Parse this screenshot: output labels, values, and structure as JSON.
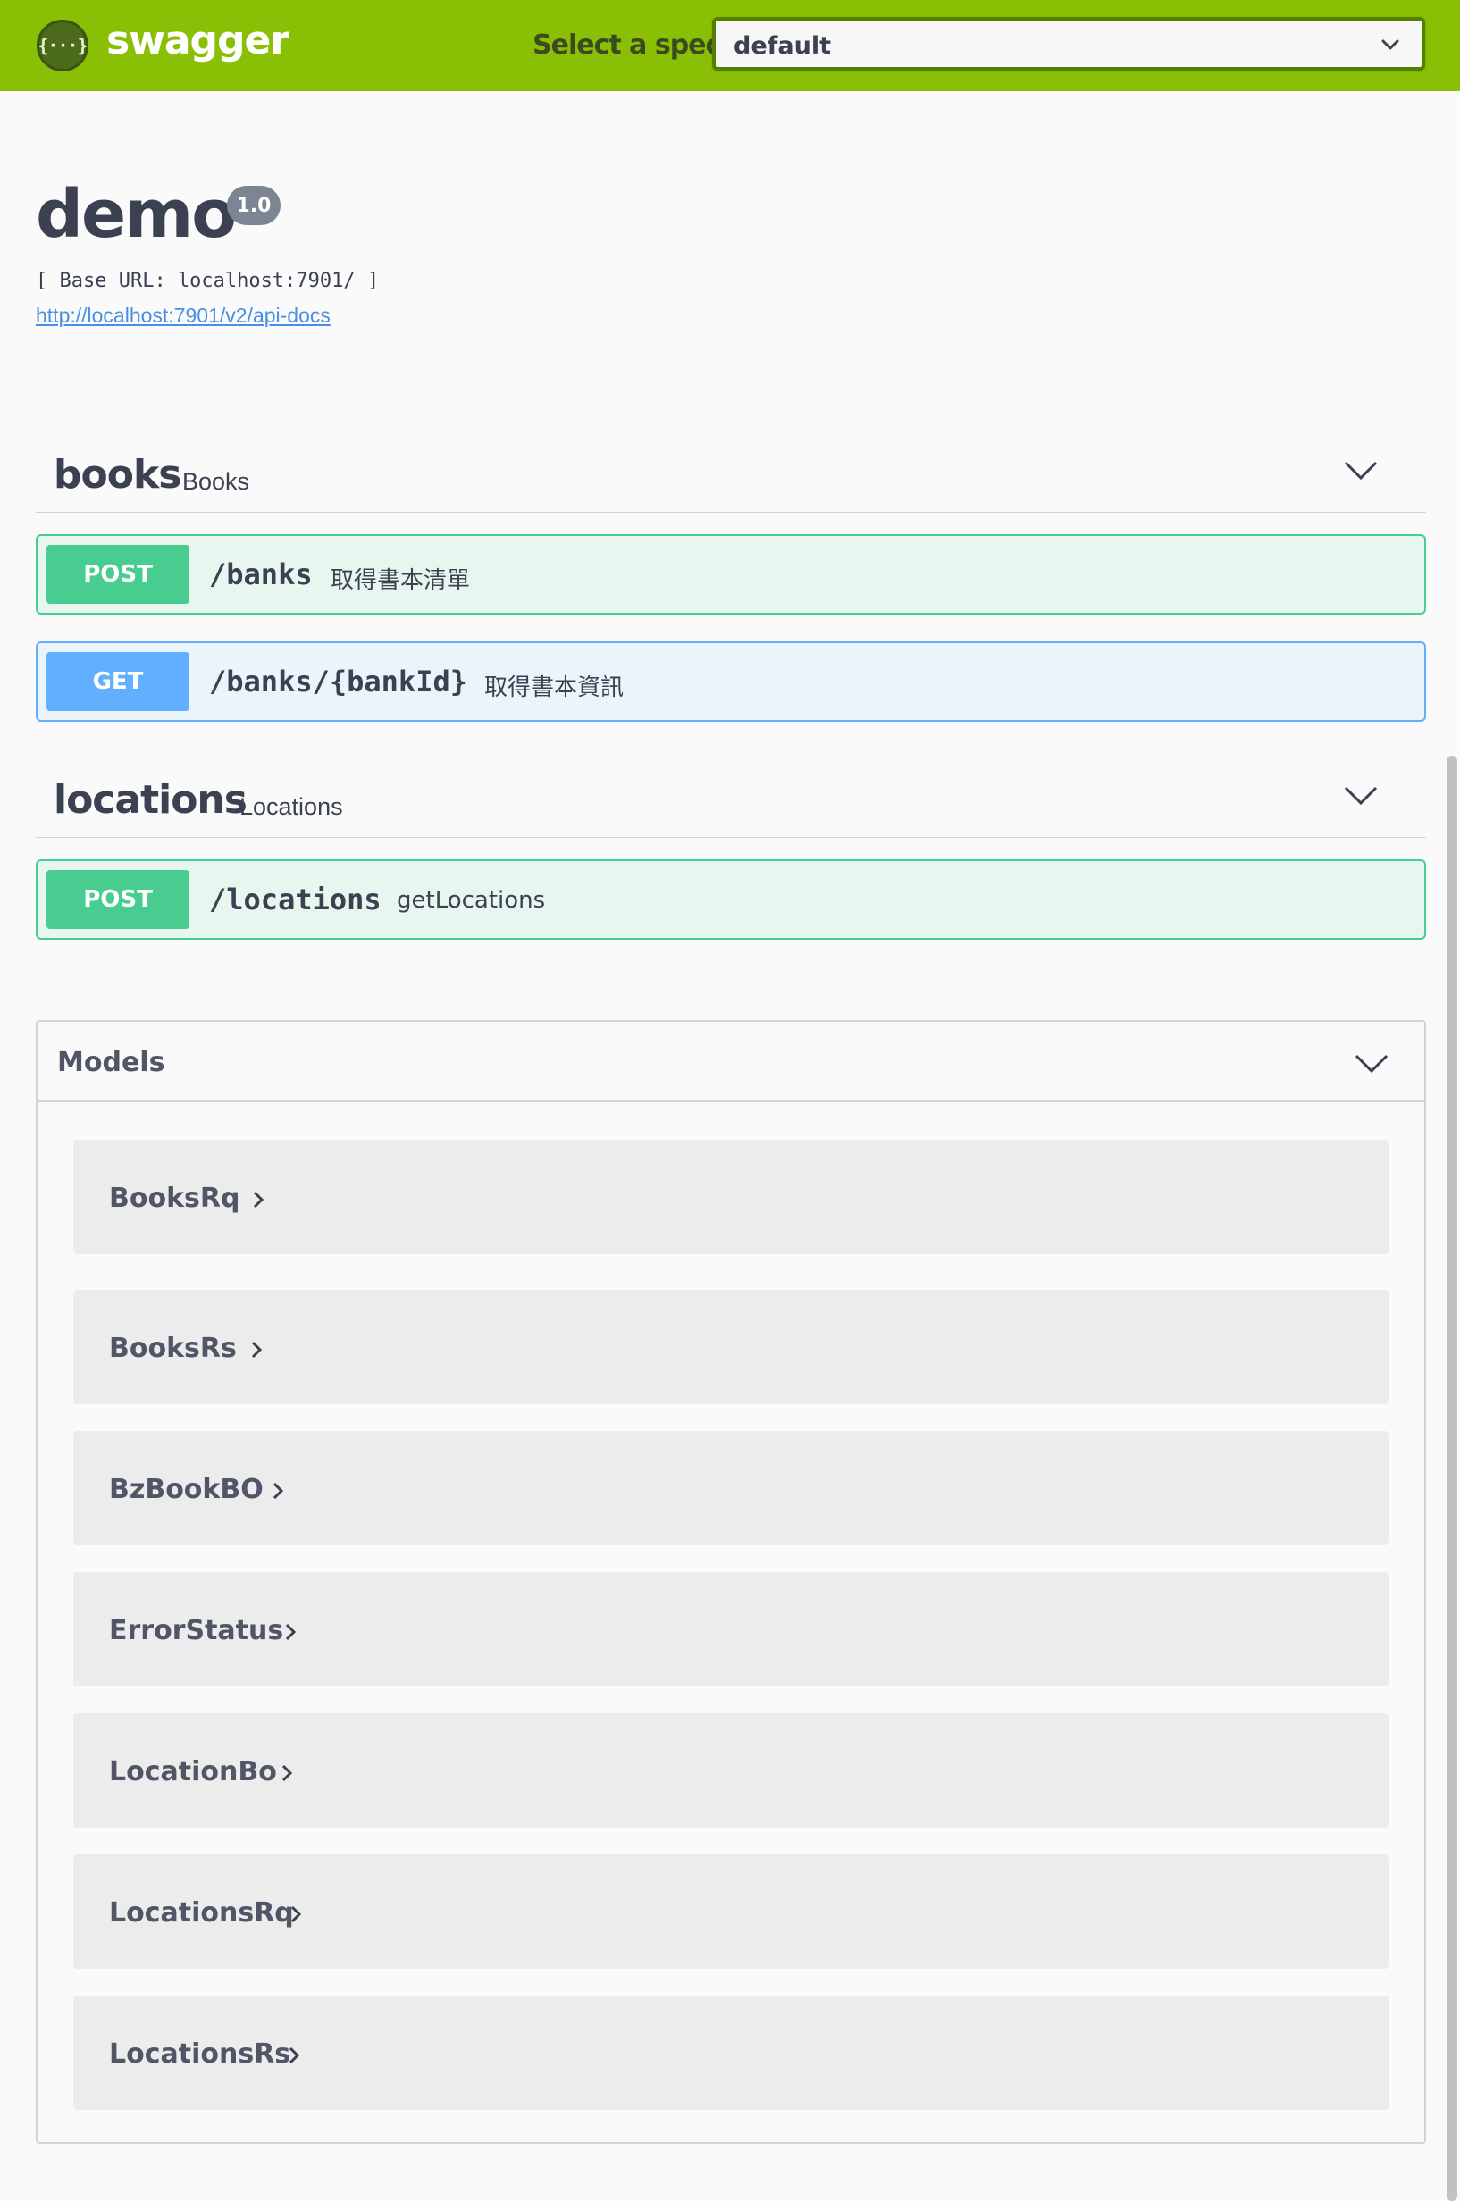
{
  "topbar": {
    "logo_glyph": "{···}",
    "logo_text": "swagger",
    "spec_label": "Select a spec",
    "spec_value": "default",
    "background_color": "#89bf04"
  },
  "info": {
    "title": "demo",
    "version": "1.0",
    "base_url": "[ Base URL: localhost:7901/ ]",
    "api_docs_link": "http://localhost:7901/v2/api-docs"
  },
  "tags": [
    {
      "name": "books",
      "description": "Books",
      "operations": [
        {
          "method": "POST",
          "path": "/banks",
          "summary": "取得書本清單"
        },
        {
          "method": "GET",
          "path": "/banks/{bankId}",
          "summary": "取得書本資訊"
        }
      ]
    },
    {
      "name": "locations",
      "description": "Locations",
      "operations": [
        {
          "method": "POST",
          "path": "/locations",
          "summary": "getLocations"
        }
      ]
    }
  ],
  "models": {
    "label": "Models",
    "items": [
      "BooksRq",
      "BooksRs",
      "BzBookBO",
      "ErrorStatus",
      "LocationBo",
      "LocationsRq",
      "LocationsRs"
    ]
  },
  "icons": {
    "spec_dropdown": "chevron-down-icon",
    "tag_toggle": "chevron-down-icon",
    "model_expand": "chevron-right-icon"
  },
  "colors": {
    "post": "#49cc90",
    "get": "#61affe",
    "link": "#4990e2"
  }
}
